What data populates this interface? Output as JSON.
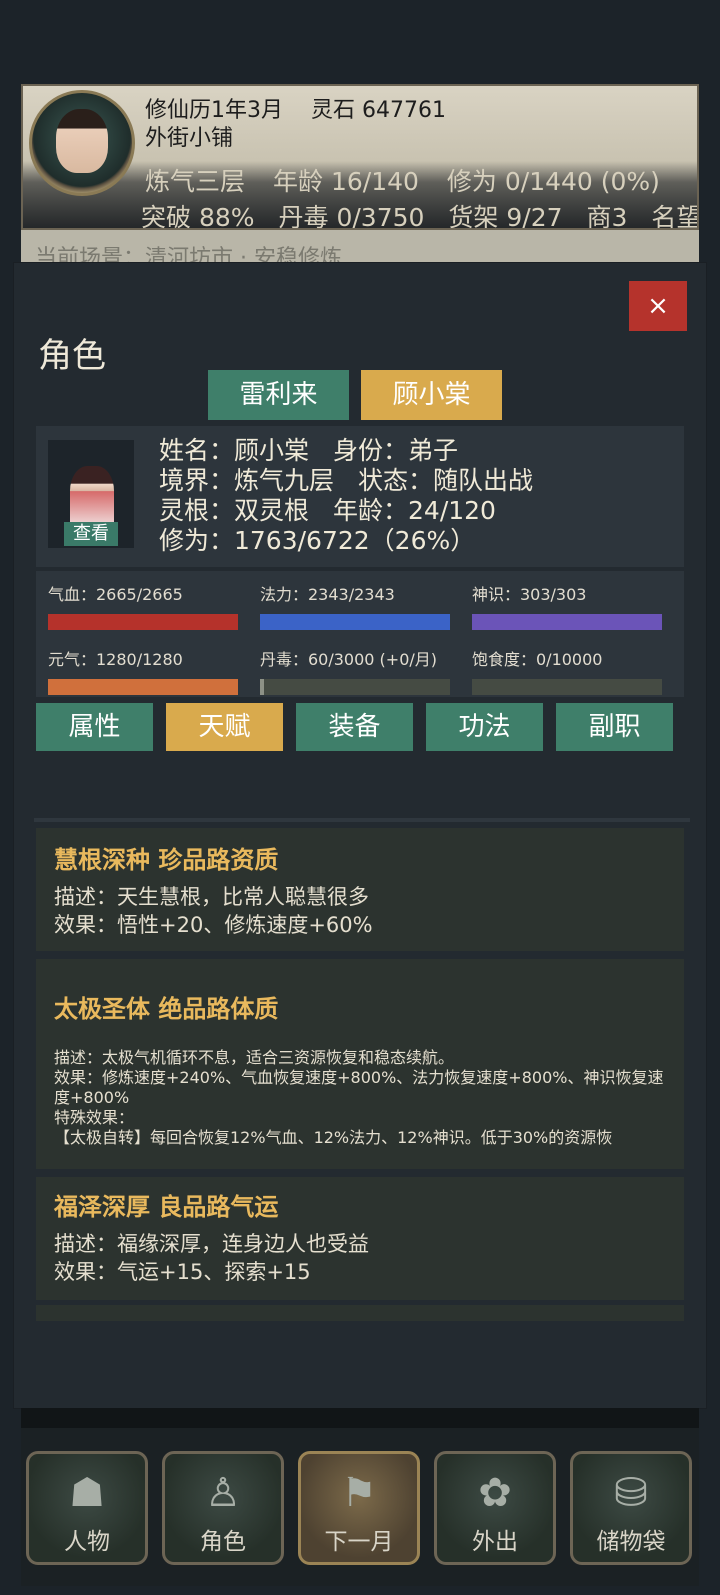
{
  "header": {
    "line1": [
      "修仙历1年3月",
      "灵石 647761"
    ],
    "line2": "外街小铺",
    "line3": [
      "炼气三层",
      "年龄 16/140",
      "修为 0/1440 (0%)"
    ],
    "line4": [
      "突破 88%",
      "丹毒 0/3750",
      "货架 9/27",
      "商3",
      "名望"
    ],
    "behind_text": "当前场景：清河坊市 · 安稳修炼"
  },
  "modal": {
    "close_label": "×",
    "title": "角色",
    "characters": [
      {
        "label": "雷利来",
        "active": false
      },
      {
        "label": "顾小棠",
        "active": true
      }
    ],
    "view_label": "查看",
    "info": {
      "name": "姓名：顾小棠",
      "identity": "身份：弟子",
      "realm": "境界：炼气九层",
      "status": "状态：随队出战",
      "root": "灵根：双灵根",
      "age": "年龄：24/120",
      "cultivation": "修为：1763/6722（26%）"
    },
    "stats": [
      {
        "label": "气血：2665/2665",
        "fill": 1.0,
        "color": "#b5322b"
      },
      {
        "label": "法力：2343/2343",
        "fill": 1.0,
        "color": "#3b63c7"
      },
      {
        "label": "神识：303/303",
        "fill": 1.0,
        "color": "#6b54b8"
      },
      {
        "label": "元气：1280/1280",
        "fill": 1.0,
        "color": "#d0703c"
      },
      {
        "label": "丹毒：60/3000 (+0/月)",
        "fill": 0.02,
        "color": "#8d9186"
      },
      {
        "label": "饱食度：0/10000",
        "fill": 0.0,
        "color": "#8d9186"
      }
    ],
    "sub_tabs": [
      {
        "label": "属性",
        "active": false
      },
      {
        "label": "天赋",
        "active": true
      },
      {
        "label": "装备",
        "active": false
      },
      {
        "label": "功法",
        "active": false
      },
      {
        "label": "副职",
        "active": false
      }
    ],
    "talents": [
      {
        "title": "慧根深种 珍品路资质",
        "lines": [
          "描述：天生慧根，比常人聪慧很多",
          "效果：悟性+20、修炼速度+60%"
        ]
      },
      {
        "title": "太极圣体 绝品路体质",
        "lines": [
          "描述：太极气机循环不息，适合三资源恢复和稳态续航。",
          "效果：修炼速度+240%、气血恢复速度+800%、法力恢复速度+800%、神识恢复速度+800%",
          "特殊效果：",
          "【太极自转】每回合恢复12%气血、12%法力、12%神识。低于30%的资源恢"
        ]
      },
      {
        "title": "福泽深厚 良品路气运",
        "lines": [
          "描述：福缘深厚，连身边人也受益",
          "效果：气运+15、探索+15"
        ]
      }
    ]
  },
  "nav": [
    {
      "label": "人物",
      "icon": "person-icon",
      "active": false
    },
    {
      "label": "角色",
      "icon": "character-icon",
      "active": false
    },
    {
      "label": "下一月",
      "icon": "flag-icon",
      "active": true
    },
    {
      "label": "外出",
      "icon": "flower-icon",
      "active": false
    },
    {
      "label": "储物袋",
      "icon": "bag-icon",
      "active": false
    }
  ]
}
